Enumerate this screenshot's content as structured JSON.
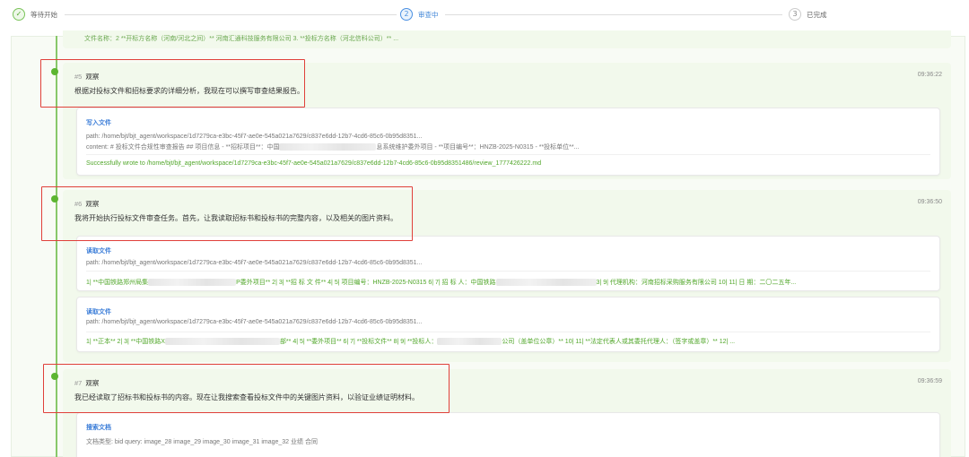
{
  "stepper": {
    "steps": [
      {
        "num": "✓",
        "label": "等待开始",
        "state": "done"
      },
      {
        "num": "2",
        "label": "审查中",
        "state": "active"
      },
      {
        "num": "3",
        "label": "已完成",
        "state": "pending"
      }
    ]
  },
  "prev_tail": "文件名称：2 **开标方名称（河南/河北之间）** 河南汇通科技服务有限公司 3. **投标方名称（河北信科公司）** ...",
  "observations": [
    {
      "num": "#5",
      "title": "观察",
      "time": "09:36:22",
      "desc": "根据对投标文件和招标要求的详细分析，我现在可以撰写审查结果报告。",
      "tools": [
        {
          "name": "写入文件",
          "path": "path: /home/bjt/bjt_agent/workspace/1d7279ca-e3bc-45f7-ae0e-545a021a7629/c837e6dd-12b7-4cd6-85c6-0b95d8351...",
          "content_a": "content: # 投标文件合规性审查报告 ## 项目信息 - **招标项目**：中国",
          "content_b": "息系统维护委外项目 - **项目编号**：HNZB-2025-N0315 - **投标单位**...",
          "result": "Successfully wrote to /home/bjt/bjt_agent/workspace/1d7279ca-e3bc-45f7-ae0e-545a021a7629/c837e6dd-12b7-4cd6-85c6-0b95d8351486/review_1777426222.md"
        }
      ]
    },
    {
      "num": "#6",
      "title": "观察",
      "time": "09:36:50",
      "desc": "我将开始执行投标文件审查任务。首先，让我读取招标书和投标书的完整内容，以及相关的图片资料。",
      "tools": [
        {
          "name": "读取文件",
          "path": "path: /home/bjt/bjt_agent/workspace/1d7279ca-e3bc-45f7-ae0e-545a021a7629/c837e6dd-12b7-4cd6-85c6-0b95d8351...",
          "result_a": "1| **中国铁路郑州局集",
          "result_b": "P委外项目** 2| 3| **招 标 文 件** 4| 5| 项目编号：HNZB-2025-N0315 6| 7| 招 标 人：中国铁路",
          "result_c": "3| 9| 代理机构：河南招标采购服务有限公司 10| 11| 日 期：二〇二五年..."
        },
        {
          "name": "读取文件",
          "path": "path: /home/bjt/bjt_agent/workspace/1d7279ca-e3bc-45f7-ae0e-545a021a7629/c837e6dd-12b7-4cd6-85c6-0b95d8351...",
          "result_a": "1| **正本** 2| 3| **中国铁路X",
          "result_b": "部** 4| 5| **委外项目** 6| 7| **投标文件** 8| 9| **投标人：",
          "result_c": "公司（盖单位公章）** 10| 11| **法定代表人或其委托代理人：（签字或盖章）** 12| ..."
        }
      ]
    },
    {
      "num": "#7",
      "title": "观察",
      "time": "09:36:59",
      "desc": "我已经读取了招标书和投标书的内容。现在让我搜索查看投标文件中的关键图片资料，以验证业绩证明材料。",
      "tools": [
        {
          "name": "搜索文档",
          "query": "文档类型: bid    query: image_28 image_29 image_30 image_31 image_32 业绩 合同"
        }
      ]
    }
  ],
  "colors": {
    "accent_green": "#5cb531",
    "link_blue": "#3b7dd8",
    "highlight_red": "#e0403a"
  }
}
